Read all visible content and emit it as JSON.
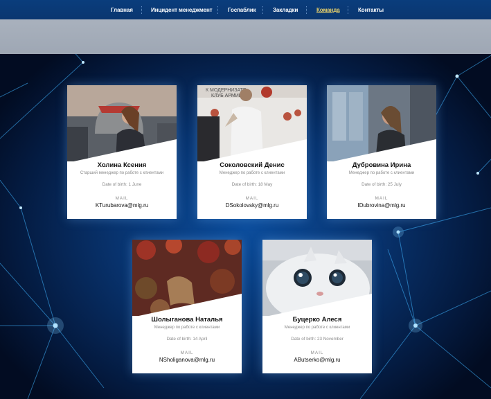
{
  "nav": {
    "items": [
      {
        "label": "Главная",
        "active": false
      },
      {
        "label": "Инцидент менеджмент",
        "active": false
      },
      {
        "label": "Госпаблик",
        "active": false
      },
      {
        "label": "Закладки",
        "active": false
      },
      {
        "label": "Команда",
        "active": true
      },
      {
        "label": "Контакты",
        "active": false
      }
    ]
  },
  "colors": {
    "nav_bg": "#0a3a76",
    "nav_active": "#e8d06a",
    "hero_band": "#a3acb8",
    "page_bg": "#04183a"
  },
  "team": [
    {
      "name": "Холина Ксения",
      "role": "Старший менеджер по работе с клиентами",
      "dob": "Date of birth: 1 June",
      "mail_label": "MAIL",
      "email": "KTurubarova@mlg.ru"
    },
    {
      "name": "Соколовский Денис",
      "role": "Менеджер по работе с клиентами",
      "dob": "Date of birth: 18 May",
      "mail_label": "MAIL",
      "email": "DSokolovsky@mlg.ru"
    },
    {
      "name": "Дубровина Ирина",
      "role": "Менеджер по работе с клиентами",
      "dob": "Date of birth: 25 July",
      "mail_label": "MAIL",
      "email": "IDubrovina@mlg.ru"
    },
    {
      "name": "Шолыганова Наталья",
      "role": "Менеджер по работе с клиентами",
      "dob": "Date of birth: 14 April",
      "mail_label": "MAIL",
      "email": "NSholiganova@mlg.ru"
    },
    {
      "name": "Буцерко Алеся",
      "role": "Менеджер по работе с клиентами",
      "dob": "Date of birth: 23 November",
      "mail_label": "MAIL",
      "email": "AButserko@mlg.ru"
    }
  ]
}
